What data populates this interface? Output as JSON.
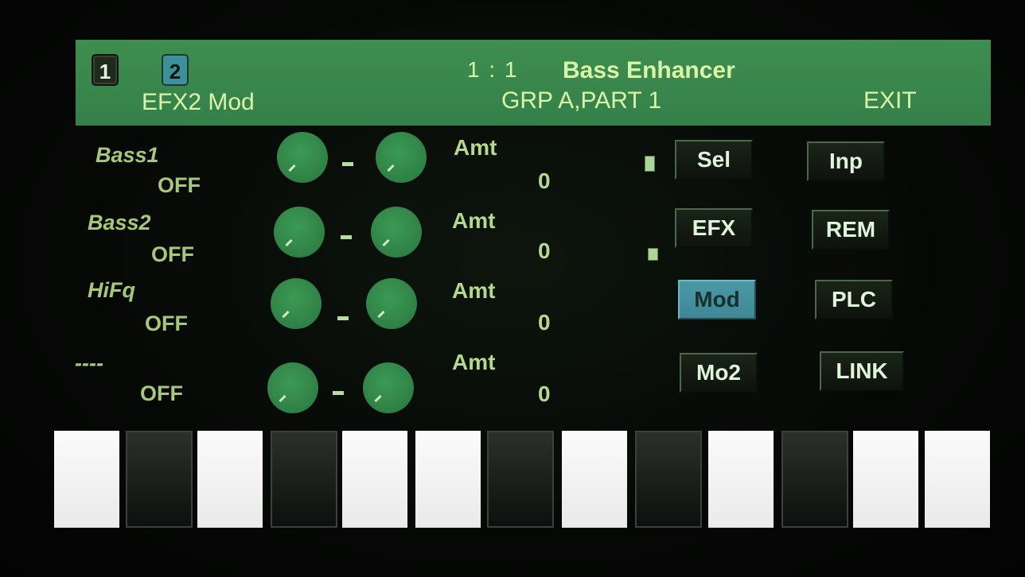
{
  "header": {
    "page_buttons": [
      "1",
      "2"
    ],
    "active_page": "2",
    "page_name": "EFX2 Mod",
    "position": "1 : 1",
    "effect_name": "Bass Enhancer",
    "group_part": "GRP A,PART 1",
    "exit_label": "EXIT"
  },
  "rows": [
    {
      "label": "Bass1",
      "value": "OFF",
      "amt_label": "Amt",
      "amt_value": "0"
    },
    {
      "label": "Bass2",
      "value": "OFF",
      "amt_label": "Amt",
      "amt_value": "0"
    },
    {
      "label": "HiFq",
      "value": "OFF",
      "amt_label": "Amt",
      "amt_value": "0"
    },
    {
      "label": "----",
      "value": "OFF",
      "amt_label": "Amt",
      "amt_value": "0"
    }
  ],
  "buttons": {
    "sel": "Sel",
    "inp": "Inp",
    "efx": "EFX",
    "rem": "REM",
    "mod": "Mod",
    "plc": "PLC",
    "mo2": "Mo2",
    "link": "LINK"
  },
  "active_button": "Mod",
  "keyboard": [
    "white",
    "black",
    "white",
    "black",
    "white",
    "white",
    "black",
    "white",
    "black",
    "white",
    "black",
    "white",
    "white"
  ],
  "colors": {
    "header_bg": "#3e8e4f",
    "text_green": "#a7c87b",
    "active_button": "#4b98a6",
    "knob": "#2f8045"
  }
}
